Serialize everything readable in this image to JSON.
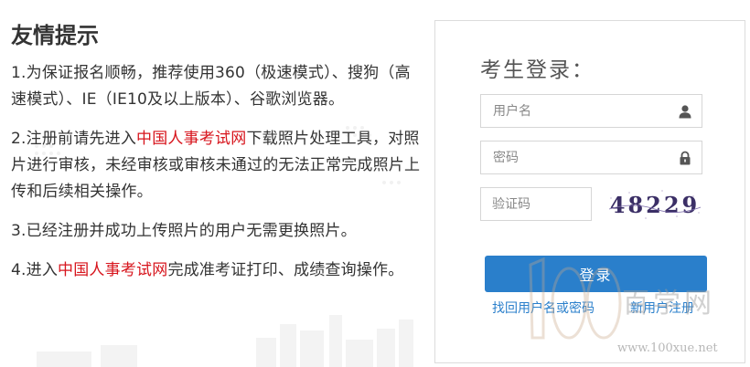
{
  "tips": {
    "title": "友情提示",
    "items": [
      {
        "text": "1.为保证报名顺畅，推荐使用360（极速模式）、搜狗（高速模式）、IE（IE10及以上版本）、谷歌浏览器。"
      },
      {
        "prefix": "2.注册前请先进入",
        "link": "中国人事考试网",
        "suffix": "下载照片处理工具，对照片进行审核，未经审核或审核未通过的无法正常完成照片上传和后续相关操作。"
      },
      {
        "text": "3.已经注册并成功上传照片的用户无需更换照片。"
      },
      {
        "prefix": "4.进入",
        "link": "中国人事考试网",
        "suffix": "完成准考证打印、成绩查询操作。"
      }
    ]
  },
  "login": {
    "title": "考生登录：",
    "username_placeholder": "用户名",
    "password_placeholder": "密码",
    "captcha_placeholder": "验证码",
    "captcha_text": "48229",
    "submit_label": "登录",
    "forgot_link": "找回用户名或密码",
    "register_link": "新用户注册"
  },
  "watermark": {
    "logo_number": "100",
    "logo_text": "百学网",
    "url": "www.100xue.net"
  },
  "colors": {
    "accent_red": "#d7141c",
    "primary_blue": "#2a7fcb",
    "border": "#dcdcdc",
    "text": "#333333"
  },
  "icons": [
    "user-icon",
    "lock-icon"
  ]
}
